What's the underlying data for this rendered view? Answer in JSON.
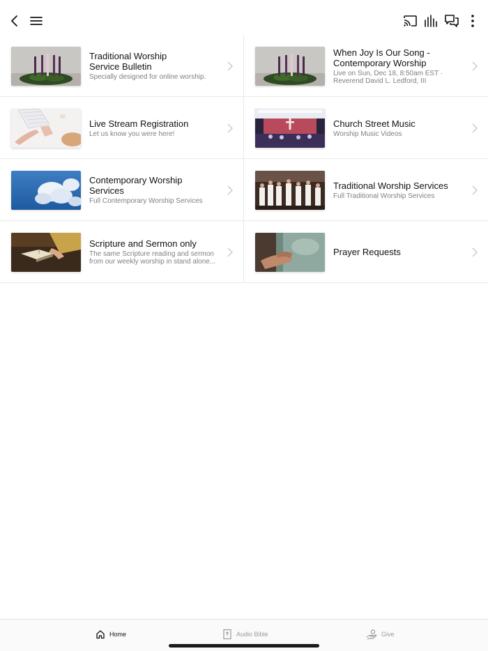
{
  "topbar": {
    "back_icon": "chevron-left-icon",
    "menu_icon": "hamburger-menu-icon",
    "cast_icon": "cast-icon",
    "audio_icon": "audio-levels-icon",
    "chat_icon": "chat-bubbles-icon",
    "more_icon": "vertical-dots-icon"
  },
  "cards": [
    {
      "title": "Traditional Worship\nService Bulletin",
      "subtitle": "Specially designed for online worship.",
      "thumb": "advent-candles"
    },
    {
      "title": "When Joy Is Our Song -\nContemporary Worship",
      "subtitle": "Live on Sun, Dec 18, 8:50am EST ·\nReverend David L. Ledford, III",
      "thumb": "advent-candles"
    },
    {
      "title": "Live Stream Registration",
      "subtitle": "Let us know you were here!",
      "thumb": "keyboard-hands"
    },
    {
      "title": "Church Street Music",
      "subtitle": "Worship Music Videos",
      "thumb": "church-stage"
    },
    {
      "title": "Contemporary Worship Services",
      "subtitle": "Full Contemporary Worship Services",
      "thumb": "sky-clouds"
    },
    {
      "title": "Traditional Worship Services",
      "subtitle": "Full Traditional Worship Services",
      "thumb": "choir"
    },
    {
      "title": "Scripture and Sermon only",
      "subtitle": "The same Scripture reading and sermon\nfrom our weekly worship in stand alone...",
      "thumb": "open-bible"
    },
    {
      "title": "Prayer Requests",
      "subtitle": "",
      "thumb": "praying-hands"
    }
  ],
  "bottom_nav": {
    "home": {
      "label": "Home",
      "icon": "home-icon",
      "active": true
    },
    "bible": {
      "label": "Audio Bible",
      "icon": "bible-icon",
      "active": false
    },
    "give": {
      "label": "Give",
      "icon": "giving-hand-icon",
      "active": false
    }
  },
  "colors": {
    "active_nav": "#111111",
    "inactive_nav": "#9a9a9a",
    "divider": "#e9e9e9"
  }
}
